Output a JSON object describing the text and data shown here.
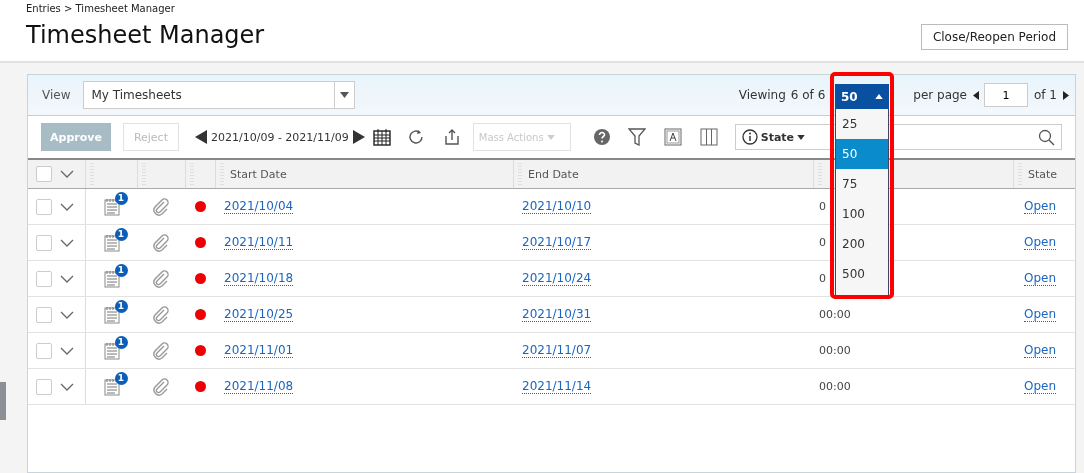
{
  "breadcrumb": "Entries > Timesheet Manager",
  "title": "Timesheet Manager",
  "header_button": "Close/Reopen Period",
  "view": {
    "label": "View",
    "value": "My Timesheets"
  },
  "pager": {
    "viewing_label": "Viewing",
    "count": "6 of 6",
    "per_page_value": "50",
    "per_page_label": "per page",
    "page": "1",
    "of_pages": "of 1"
  },
  "per_page_options": [
    {
      "label": "25",
      "selected": false
    },
    {
      "label": "50",
      "selected": true
    },
    {
      "label": "75",
      "selected": false
    },
    {
      "label": "100",
      "selected": false
    },
    {
      "label": "200",
      "selected": false
    },
    {
      "label": "500",
      "selected": false
    }
  ],
  "toolbar": {
    "approve": {
      "label": "Approve",
      "disabled": true
    },
    "reject": {
      "label": "Reject",
      "disabled": true
    },
    "date_range": "2021/10/09 - 2021/11/09",
    "mass_actions": {
      "label": "Mass Actions",
      "disabled": true
    },
    "filter_label": "State"
  },
  "select_all": {
    "checked": false
  },
  "columns": [
    "Start Date",
    "End Date",
    "State"
  ],
  "rows": [
    {
      "notes": "1",
      "color": "#ee0000",
      "start": "2021/10/04",
      "end": "2021/10/10",
      "hours": "0",
      "state": "Open",
      "checked": false
    },
    {
      "notes": "1",
      "color": "#ee0000",
      "start": "2021/10/11",
      "end": "2021/10/17",
      "hours": "0",
      "state": "Open",
      "checked": false
    },
    {
      "notes": "1",
      "color": "#ee0000",
      "start": "2021/10/18",
      "end": "2021/10/24",
      "hours": "0",
      "state": "Open",
      "checked": false
    },
    {
      "notes": "1",
      "color": "#ee0000",
      "start": "2021/10/25",
      "end": "2021/10/31",
      "hours": "00:00",
      "state": "Open",
      "checked": false
    },
    {
      "notes": "1",
      "color": "#ee0000",
      "start": "2021/11/01",
      "end": "2021/11/07",
      "hours": "00:00",
      "state": "Open",
      "checked": false
    },
    {
      "notes": "1",
      "color": "#ee0000",
      "start": "2021/11/08",
      "end": "2021/11/14",
      "hours": "00:00",
      "state": "Open",
      "checked": false
    }
  ]
}
